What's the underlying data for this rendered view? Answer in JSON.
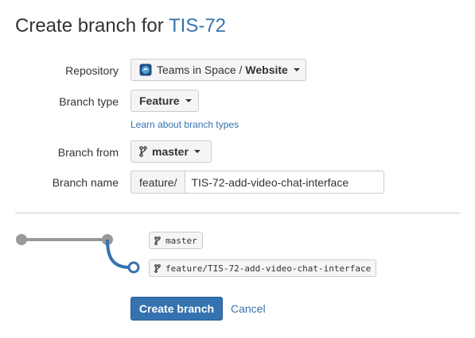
{
  "header": {
    "title_prefix": "Create branch for",
    "issue_key": "TIS-72"
  },
  "form": {
    "repository": {
      "label": "Repository",
      "project": "Teams in Space /",
      "repo": "Website"
    },
    "branch_type": {
      "label": "Branch type",
      "value": "Feature",
      "help_link": "Learn about branch types"
    },
    "branch_from": {
      "label": "Branch from",
      "value": "master"
    },
    "branch_name": {
      "label": "Branch name",
      "prefix": "feature/",
      "value": "TIS-72-add-video-chat-interface"
    }
  },
  "preview": {
    "source_branch": "master",
    "new_branch": "feature/TIS-72-add-video-chat-interface",
    "colors": {
      "base_line": "#999999",
      "new_line": "#3572b0"
    }
  },
  "actions": {
    "create_label": "Create branch",
    "cancel_label": "Cancel"
  },
  "colors": {
    "accent": "#3572b0"
  },
  "icons": {
    "repository": "repository-avatar-icon",
    "branch": "branch-icon",
    "dropdown": "chevron-down-icon"
  }
}
